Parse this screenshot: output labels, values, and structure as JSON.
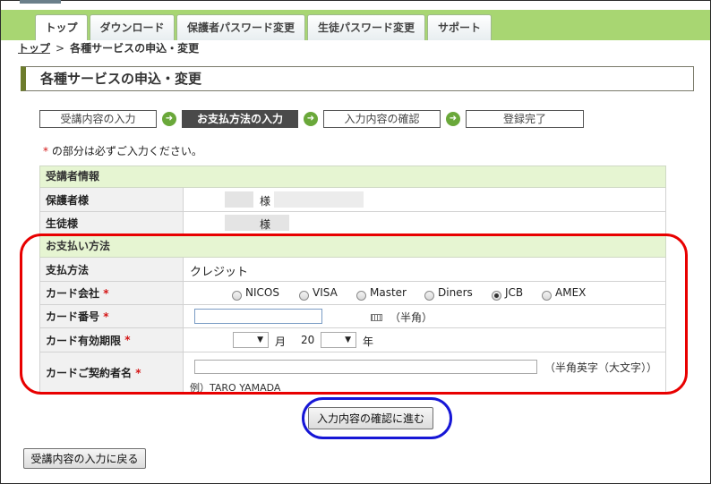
{
  "tabs": [
    {
      "label": "トップ"
    },
    {
      "label": "ダウンロード"
    },
    {
      "label": "保護者パスワード変更"
    },
    {
      "label": "生徒パスワード変更"
    },
    {
      "label": "サポート"
    }
  ],
  "breadcrumb": {
    "home": "トップ",
    "separator": ">",
    "current": "各種サービスの申込・変更"
  },
  "page_title": "各種サービスの申込・変更",
  "steps": [
    {
      "label": "受講内容の入力",
      "current": false
    },
    {
      "label": "お支払方法の入力",
      "current": true
    },
    {
      "label": "入力内容の確認",
      "current": false
    },
    {
      "label": "登録完了",
      "current": false
    }
  ],
  "required_note": {
    "mark": "*",
    "text": " の部分は必ずご入力ください。"
  },
  "student_info": {
    "heading": "受講者情報",
    "guardian_label": "保護者様",
    "student_label": "生徒様",
    "honorific": "様"
  },
  "payment": {
    "heading": "お支払い方法",
    "method_label": "支払方法",
    "method_value": "クレジット",
    "card_company_label": "カード会社",
    "card_companies": [
      {
        "label": "NICOS",
        "checked": false
      },
      {
        "label": "VISA",
        "checked": false
      },
      {
        "label": "Master",
        "checked": false
      },
      {
        "label": "Diners",
        "checked": false
      },
      {
        "label": "JCB",
        "checked": true
      },
      {
        "label": "AMEX",
        "checked": false
      }
    ],
    "card_number_label": "カード番号",
    "card_number_value": "",
    "card_number_hint": "（半角）",
    "expiry_label": "カード有効期限",
    "expiry_month_unit": "月",
    "expiry_year_prefix": "20",
    "expiry_year_unit": "年",
    "holder_label": "カードご契約者名",
    "holder_value": "",
    "holder_hint": "（半角英字（大文字））",
    "holder_example": "例）TARO YAMADA",
    "required_mark": "*",
    "dropdown_glyph": "▼"
  },
  "buttons": {
    "confirm": "入力内容の確認に進む",
    "back": "受講内容の入力に戻る"
  },
  "colors": {
    "tabbar": "#a8d672",
    "section_head": "#e6f5d2",
    "required": "#d41616",
    "highlight_red": "#e80000",
    "highlight_blue": "#1616d6"
  }
}
